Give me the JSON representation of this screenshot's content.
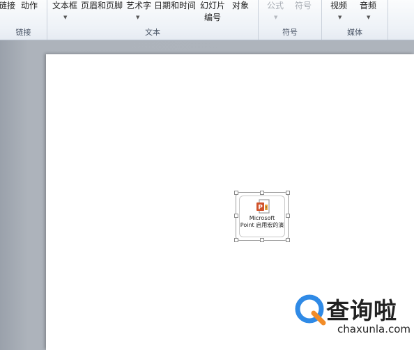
{
  "ribbon": {
    "groups": [
      {
        "label": "链接",
        "commands": [
          {
            "label": "链接"
          },
          {
            "label": "动作"
          }
        ]
      },
      {
        "label": "文本",
        "commands": [
          {
            "label": "文本框"
          },
          {
            "label": "页眉和页脚"
          },
          {
            "label": "艺术字"
          },
          {
            "label": "日期和时间"
          },
          {
            "label": "幻灯片",
            "label2": "编号"
          },
          {
            "label": "对象"
          }
        ]
      },
      {
        "label": "符号",
        "commands": [
          {
            "label": "公式"
          },
          {
            "label": "符号"
          }
        ]
      },
      {
        "label": "媒体",
        "commands": [
          {
            "label": "视频"
          },
          {
            "label": "音频"
          }
        ]
      }
    ]
  },
  "slide": {
    "embedded_object": {
      "icon": "powerpoint-macro-icon",
      "caption_line1": "Microsoft",
      "caption_line2": "Point 启用宏的演"
    }
  },
  "watermark": {
    "title": "查询啦",
    "subtitle": "chaxunla.com",
    "brand_color": "#2f8ae6"
  }
}
